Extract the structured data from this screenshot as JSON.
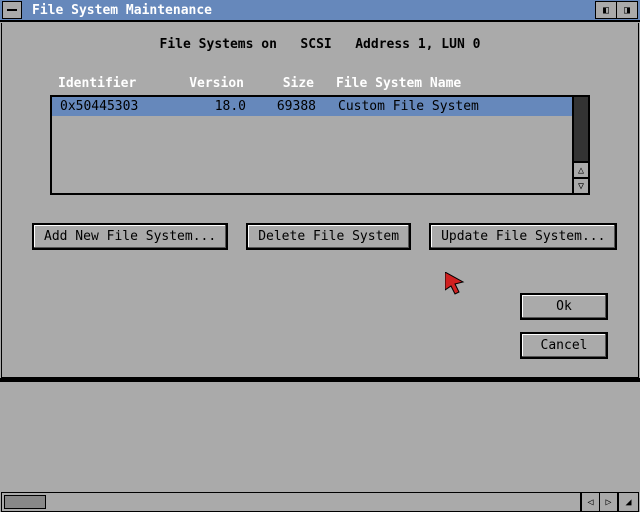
{
  "titlebar": {
    "title": "File System Maintenance"
  },
  "header": {
    "label_prefix": "File Systems on",
    "bus": "SCSI",
    "address_label": "Address 1, LUN 0"
  },
  "columns": {
    "id": "Identifier",
    "ver": "Version",
    "size": "Size",
    "name": "File System Name"
  },
  "rows": [
    {
      "id": "0x50445303",
      "ver": "18.0",
      "size": "69388",
      "name": "Custom File System",
      "selected": true
    }
  ],
  "buttons": {
    "add": "Add New File System...",
    "delete": "Delete File System",
    "update": "Update File System...",
    "ok": "Ok",
    "cancel": "Cancel"
  },
  "icons": {
    "up": "△",
    "down": "▽",
    "left": "◁",
    "right": "▷"
  }
}
